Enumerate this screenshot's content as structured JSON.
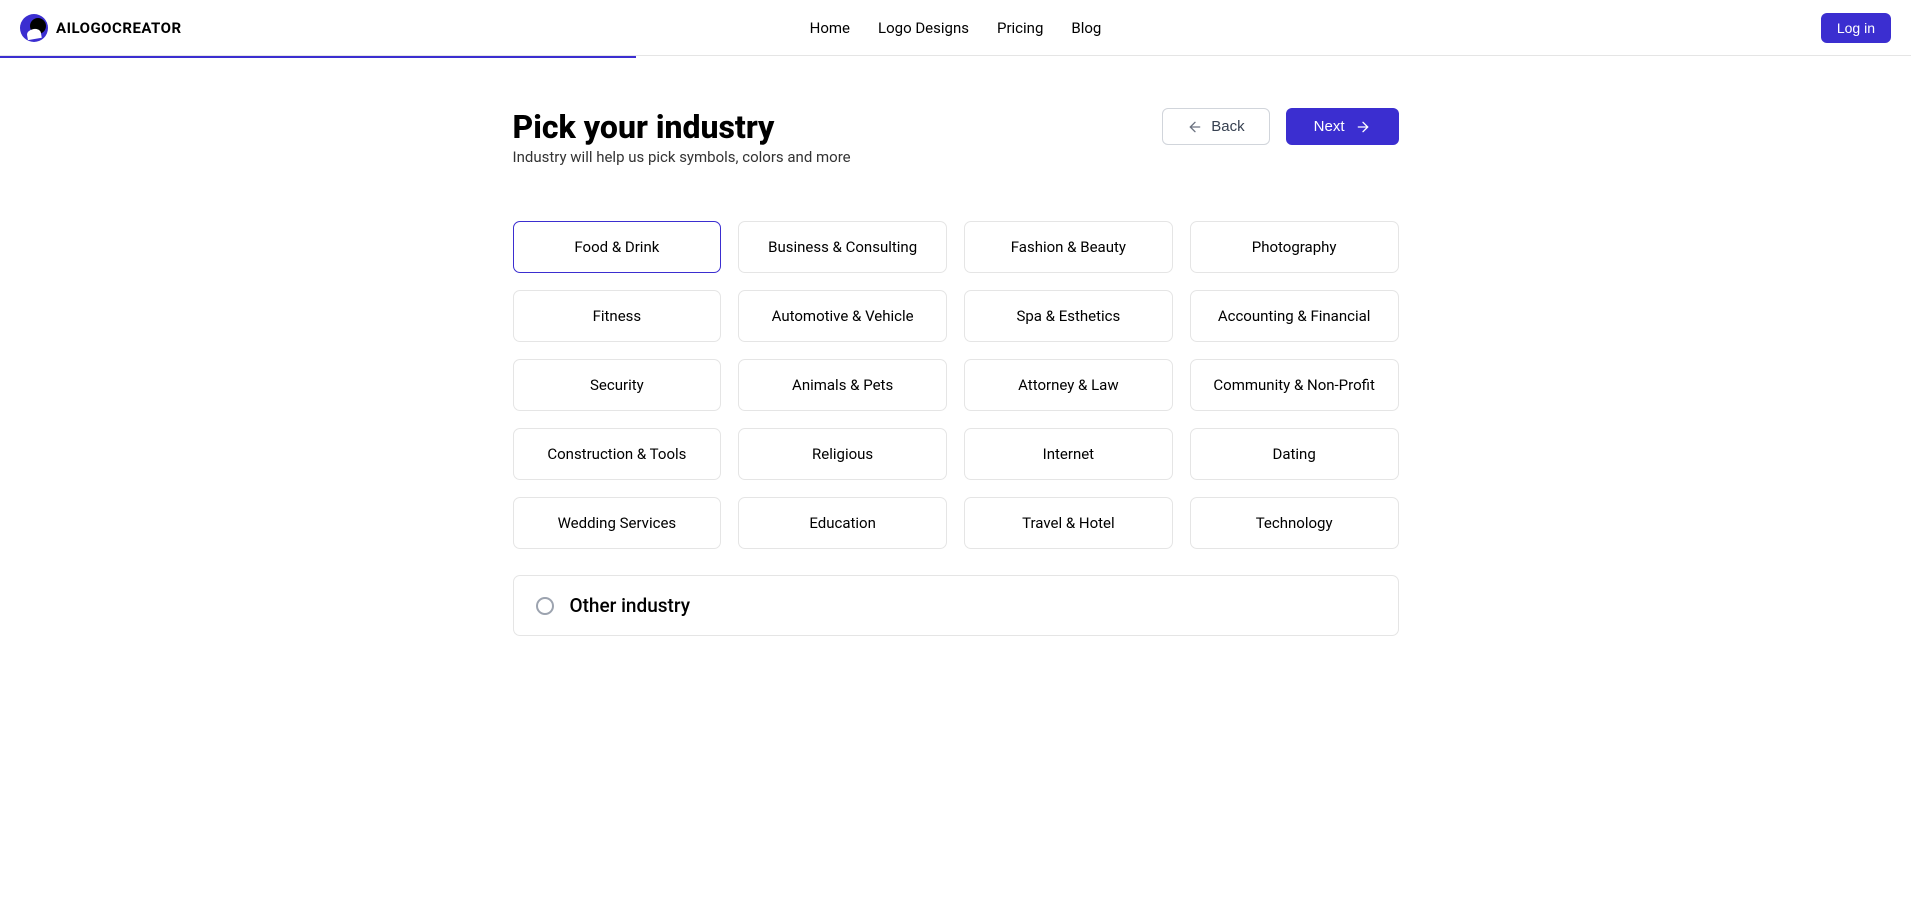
{
  "header": {
    "logo_text": "AILOGOCREATOR",
    "nav": [
      "Home",
      "Logo Designs",
      "Pricing",
      "Blog"
    ],
    "login_label": "Log in"
  },
  "page": {
    "title": "Pick your industry",
    "subtitle": "Industry will help us pick symbols, colors and more",
    "back_label": "Back",
    "next_label": "Next"
  },
  "industries": [
    "Food & Drink",
    "Business & Consulting",
    "Fashion & Beauty",
    "Photography",
    "Fitness",
    "Automotive & Vehicle",
    "Spa & Esthetics",
    "Accounting & Financial",
    "Security",
    "Animals & Pets",
    "Attorney & Law",
    "Community & Non-Profit",
    "Construction & Tools",
    "Religious",
    "Internet",
    "Dating",
    "Wedding Services",
    "Education",
    "Travel & Hotel",
    "Technology"
  ],
  "selected_industry_index": 0,
  "other_industry_label": "Other industry"
}
